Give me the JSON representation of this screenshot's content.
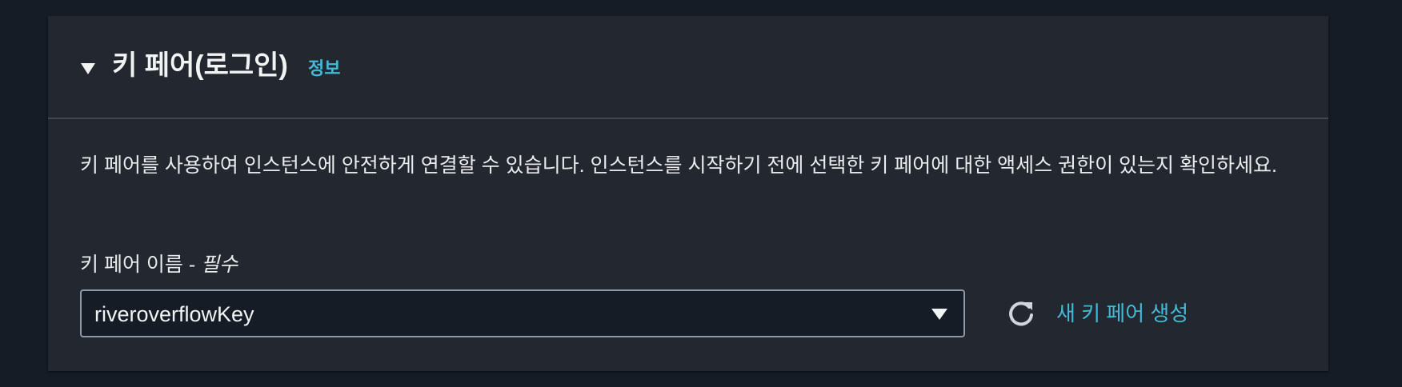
{
  "panel": {
    "title": "키 페어(로그인)",
    "info_link": "정보",
    "description": "키 페어를 사용하여 인스턴스에 안전하게 연결할 수 있습니다. 인스턴스를 시작하기 전에 선택한 키 페어에 대한 액세스 권한이 있는지 확인하세요.",
    "collapse_icon": "caret-down-icon"
  },
  "key_pair_field": {
    "label": "키 페어 이름 - ",
    "required": "필수",
    "selected_value": "riveroverflowKey",
    "dropdown_icon": "caret-down-icon"
  },
  "actions": {
    "refresh_icon": "refresh-icon",
    "create_link": "새 키 페어 생성"
  },
  "colors": {
    "background": "#161c26",
    "panel": "#232830",
    "link": "#44b9d6",
    "text": "#f2f3f3",
    "border": "#8d99a8"
  }
}
